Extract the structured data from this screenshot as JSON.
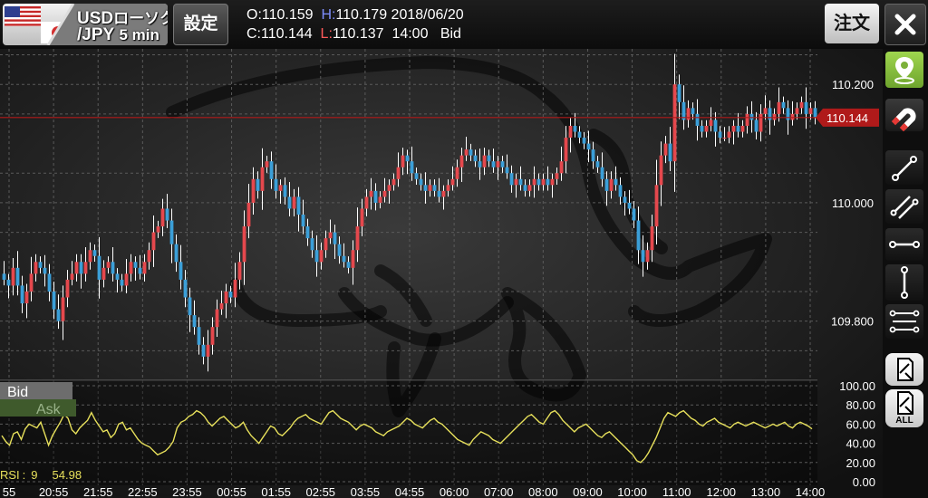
{
  "header": {
    "pair_base": "USD",
    "pair_type": "ローソク",
    "pair_quote": "/JPY",
    "timeframe": "5 min",
    "settings_label": "設定",
    "open_label": "O:",
    "open_value": "110.159",
    "high_label": "H:",
    "high_value": "110.179",
    "date": "2018/06/20",
    "close_label": "C:",
    "close_value": "110.144",
    "low_label": "L:",
    "low_value": "110.137",
    "time": "14:00",
    "price_type": "Bid",
    "order_label": "注文"
  },
  "colors": {
    "up": "#e5484d",
    "down": "#3b9fd8",
    "current_line": "#b01a1a",
    "rsi": "#e7e05b",
    "grid": "#5a5a5a",
    "tool_active": "#8cc63f"
  },
  "icons": {
    "close": "close-icon",
    "flag": "us-jp-flag-icon",
    "marker": "map-pin-icon",
    "magnet": "magnet-icon",
    "line": "trend-line-icon",
    "channel": "parallel-lines-icon",
    "hline": "horizontal-line-icon",
    "vline": "vertical-line-icon",
    "fib": "fibonacci-icon",
    "delete": "delete-drawing-icon",
    "delete_all": "delete-all-drawings-icon"
  },
  "sidebar": {
    "delete_all_label": "ALL"
  },
  "chart_data": [
    {
      "type": "candlestick",
      "price_axis_ticks": [
        "110.200",
        "110.000",
        "109.800"
      ],
      "ylim": [
        109.7,
        110.26
      ],
      "current_price": "110.144",
      "time_ticks": [
        "55",
        "20:55",
        "21:55",
        "22:55",
        "23:55",
        "00:55",
        "01:55",
        "02:55",
        "03:55",
        "04:55",
        "06:00",
        "07:00",
        "08:00",
        "09:00",
        "10:00",
        "11:00",
        "12:00",
        "13:00",
        "14:00"
      ],
      "toggles": [
        {
          "label": "Bid",
          "active": true
        },
        {
          "label": "Ask",
          "active": false
        }
      ],
      "close_series": [
        109.87,
        109.86,
        109.89,
        109.86,
        109.83,
        109.85,
        109.88,
        109.9,
        109.89,
        109.88,
        109.85,
        109.82,
        109.8,
        109.84,
        109.87,
        109.88,
        109.9,
        109.88,
        109.9,
        109.92,
        109.91,
        109.87,
        109.89,
        109.9,
        109.88,
        109.87,
        109.86,
        109.88,
        109.9,
        109.89,
        109.88,
        109.9,
        109.92,
        109.95,
        109.96,
        109.99,
        109.97,
        109.93,
        109.9,
        109.87,
        109.84,
        109.81,
        109.79,
        109.76,
        109.74,
        109.76,
        109.79,
        109.82,
        109.83,
        109.85,
        109.84,
        109.87,
        109.9,
        109.96,
        110.0,
        110.04,
        110.02,
        110.06,
        110.07,
        110.04,
        110.02,
        110.03,
        110.01,
        109.99,
        110.01,
        109.98,
        109.96,
        109.94,
        109.92,
        109.9,
        109.92,
        109.94,
        109.95,
        109.93,
        109.91,
        109.9,
        109.89,
        109.92,
        109.96,
        109.99,
        110.01,
        110.02,
        110.0,
        110.01,
        110.02,
        110.03,
        110.04,
        110.06,
        110.08,
        110.07,
        110.05,
        110.04,
        110.03,
        110.02,
        110.03,
        110.02,
        110.01,
        110.02,
        110.03,
        110.04,
        110.06,
        110.08,
        110.09,
        110.08,
        110.07,
        110.06,
        110.08,
        110.07,
        110.06,
        110.07,
        110.06,
        110.05,
        110.03,
        110.04,
        110.03,
        110.02,
        110.03,
        110.04,
        110.03,
        110.04,
        110.03,
        110.04,
        110.05,
        110.07,
        110.11,
        110.13,
        110.12,
        110.11,
        110.1,
        110.09,
        110.07,
        110.06,
        110.04,
        110.02,
        110.04,
        110.03,
        110.01,
        110.0,
        109.99,
        109.97,
        109.92,
        109.9,
        109.92,
        109.96,
        110.03,
        110.08,
        110.1,
        110.07,
        110.2,
        110.17,
        110.14,
        110.16,
        110.15,
        110.13,
        110.12,
        110.13,
        110.14,
        110.12,
        110.11,
        110.11,
        110.12,
        110.13,
        110.12,
        110.13,
        110.15,
        110.14,
        110.12,
        110.15,
        110.16,
        110.14,
        110.15,
        110.17,
        110.16,
        110.14,
        110.15,
        110.16,
        110.17,
        110.15,
        110.16,
        110.144
      ]
    },
    {
      "type": "line",
      "indicator": "RSI",
      "label_name": "RSI",
      "label_period": "9",
      "label_value": "54.98",
      "ylim": [
        0,
        100
      ],
      "y_ticks": [
        "100.00",
        "80.00",
        "60.00",
        "40.00",
        "20.00",
        "0.00"
      ],
      "values": [
        48,
        42,
        38,
        50,
        52,
        44,
        55,
        60,
        58,
        56,
        62,
        50,
        38,
        48,
        55,
        62,
        70,
        66,
        54,
        50,
        56,
        60,
        64,
        72,
        64,
        58,
        52,
        54,
        46,
        50,
        60,
        62,
        54,
        56,
        50,
        44,
        40,
        38,
        36,
        32,
        28,
        30,
        32,
        36,
        42,
        56,
        62,
        64,
        68,
        70,
        74,
        72,
        68,
        62,
        58,
        62,
        66,
        68,
        64,
        60,
        56,
        58,
        62,
        54,
        48,
        44,
        40,
        46,
        52,
        58,
        56,
        50,
        48,
        52,
        56,
        62,
        66,
        68,
        70,
        66,
        64,
        62,
        60,
        66,
        72,
        74,
        70,
        66,
        64,
        62,
        58,
        54,
        58,
        60,
        58,
        56,
        52,
        50,
        48,
        52,
        54,
        56,
        58,
        62,
        66,
        64,
        60,
        58,
        56,
        60,
        64,
        66,
        62,
        60,
        56,
        52,
        48,
        44,
        42,
        40,
        38,
        44,
        48,
        52,
        50,
        48,
        44,
        42,
        40,
        44,
        48,
        52,
        56,
        60,
        64,
        68,
        70,
        66,
        62,
        60,
        66,
        72,
        74,
        70,
        64,
        60,
        56,
        52,
        56,
        58,
        60,
        56,
        52,
        48,
        46,
        50,
        52,
        48,
        44,
        40,
        36,
        32,
        28,
        22,
        20,
        24,
        30,
        38,
        46,
        56,
        66,
        72,
        70,
        68,
        72,
        74,
        70,
        66,
        64,
        60,
        58,
        62,
        64,
        66,
        62,
        60,
        58,
        56,
        60,
        62,
        60,
        58,
        60,
        62,
        60,
        58,
        56,
        58,
        60,
        58,
        60,
        62,
        58,
        56,
        60,
        62,
        60,
        58,
        55
      ]
    }
  ]
}
